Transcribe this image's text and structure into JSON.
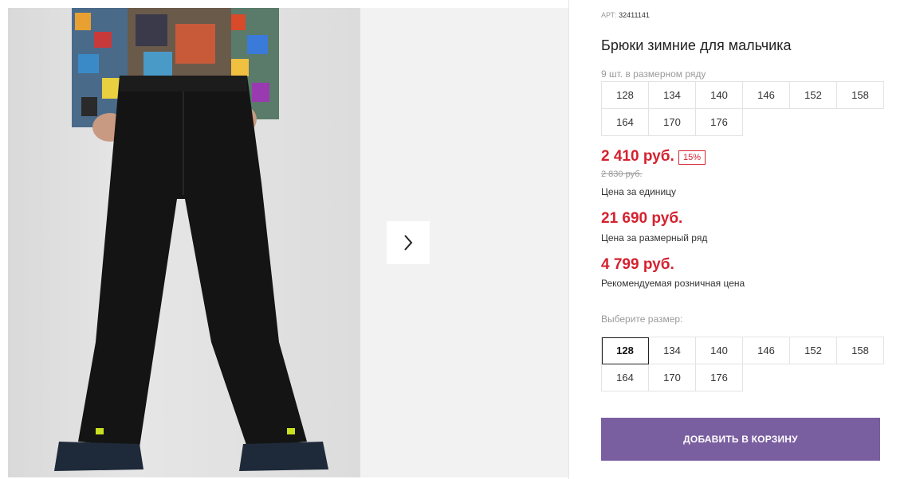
{
  "product": {
    "article_label": "АРТ:",
    "article_number": "32411141",
    "title": "Брюки зимние для мальчика",
    "pack_note": "9 шт. в размерном ряду"
  },
  "pack_sizes": [
    "128",
    "134",
    "140",
    "146",
    "152",
    "158",
    "164",
    "170",
    "176"
  ],
  "prices": {
    "unit_price": "2 410 руб.",
    "discount_badge": "15%",
    "old_price": "2 830 руб.",
    "unit_caption": "Цена за единицу",
    "pack_price": "21 690 руб.",
    "pack_caption": "Цена за размерный ряд",
    "retail_price": "4 799 руб.",
    "retail_caption": "Рекомендуемая розничная цена",
    "accent_color": "#d5212f"
  },
  "size_selector": {
    "label": "Выберите размер:",
    "selected": "128",
    "options": [
      "128",
      "134",
      "140",
      "146",
      "152",
      "158",
      "164",
      "170",
      "176"
    ]
  },
  "cart": {
    "button_label": "ДОБАВИТЬ В КОРЗИНУ",
    "button_color": "#7a5fa0"
  },
  "gallery": {
    "next_icon": "chevron-right-icon"
  }
}
